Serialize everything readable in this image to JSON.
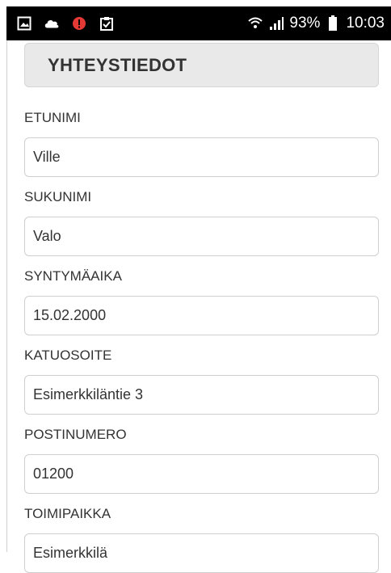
{
  "status_bar": {
    "icons_left": [
      "image-icon",
      "cloud-icon",
      "alert-icon",
      "clipboard-check-icon"
    ],
    "battery": "93%",
    "time": "10:03"
  },
  "section": {
    "title": "YHTEYSTIEDOT"
  },
  "fields": [
    {
      "label": "ETUNIMI",
      "value": "Ville"
    },
    {
      "label": "SUKUNIMI",
      "value": "Valo"
    },
    {
      "label": "SYNTYMÄAIKA",
      "value": "15.02.2000"
    },
    {
      "label": "KATUOSOITE",
      "value": "Esimerkkiläntie 3"
    },
    {
      "label": "POSTINUMERO",
      "value": "01200"
    },
    {
      "label": "TOIMIPAIKKA",
      "value": "Esimerkkilä"
    }
  ],
  "colors": {
    "status_bar_bg": "#000000",
    "alert": "#e53935",
    "header_bg": "#e9e9e9"
  }
}
